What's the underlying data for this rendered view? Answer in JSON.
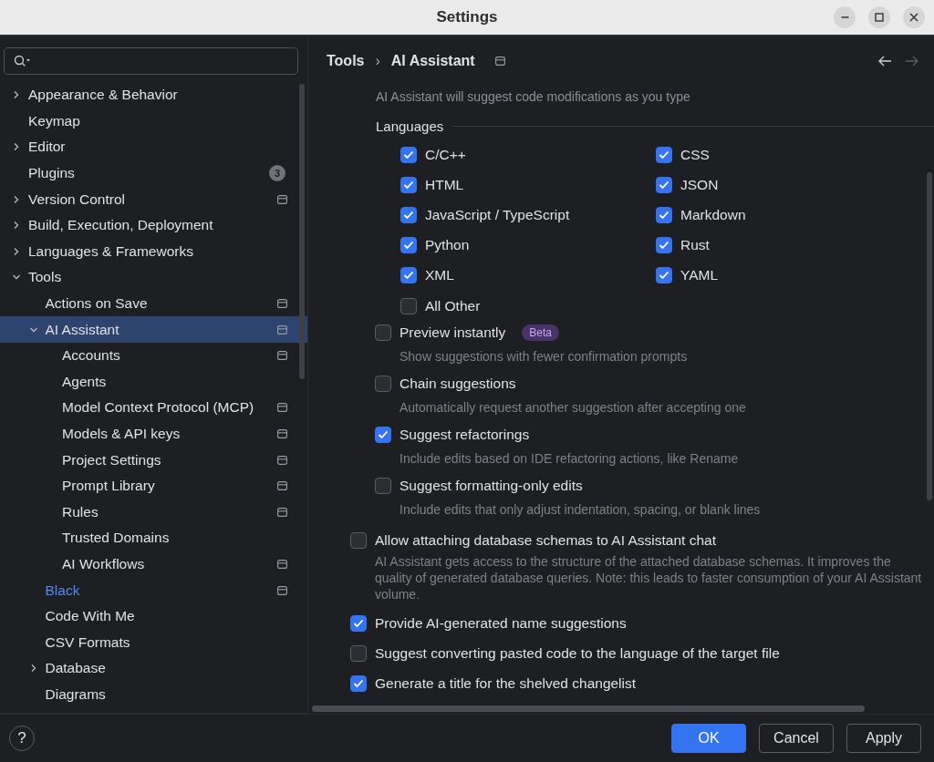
{
  "window": {
    "title": "Settings"
  },
  "sidebar": {
    "items": [
      {
        "label": "Appearance & Behavior",
        "expanded": false,
        "selected": false
      },
      {
        "label": "Keymap",
        "selected": false
      },
      {
        "label": "Editor",
        "expanded": false,
        "selected": false
      },
      {
        "label": "Plugins",
        "selected": false,
        "badge": "3"
      },
      {
        "label": "Version Control",
        "expanded": false,
        "selected": false,
        "project_scoped": true
      },
      {
        "label": "Build, Execution, Deployment",
        "expanded": false,
        "selected": false
      },
      {
        "label": "Languages & Frameworks",
        "expanded": false,
        "selected": false
      },
      {
        "label": "Tools",
        "expanded": true,
        "selected": false,
        "children": [
          {
            "label": "Actions on Save",
            "selected": false,
            "project_scoped": true
          },
          {
            "label": "AI Assistant",
            "expanded": true,
            "selected": true,
            "project_scoped": true,
            "children": [
              {
                "label": "Accounts",
                "selected": false,
                "project_scoped": true
              },
              {
                "label": "Agents",
                "selected": false
              },
              {
                "label": "Model Context Protocol (MCP)",
                "selected": false,
                "project_scoped": true
              },
              {
                "label": "Models & API keys",
                "selected": false,
                "project_scoped": true
              },
              {
                "label": "Project Settings",
                "selected": false,
                "project_scoped": true
              },
              {
                "label": "Prompt Library",
                "selected": false,
                "project_scoped": true
              },
              {
                "label": "Rules",
                "selected": false,
                "project_scoped": true
              },
              {
                "label": "Trusted Domains",
                "selected": false
              },
              {
                "label": "AI Workflows",
                "selected": false,
                "project_scoped": true
              }
            ]
          },
          {
            "label": "Black",
            "selected": false,
            "modified": true,
            "project_scoped": true
          },
          {
            "label": "Code With Me",
            "selected": false
          },
          {
            "label": "CSV Formats",
            "selected": false
          },
          {
            "label": "Database",
            "expanded": false,
            "selected": false
          },
          {
            "label": "Diagrams",
            "selected": false
          }
        ]
      }
    ]
  },
  "breadcrumb": {
    "items": [
      "Tools",
      "AI Assistant"
    ],
    "separator": "›",
    "project_scoped": true
  },
  "navigation": {
    "back_enabled": true,
    "forward_enabled": false
  },
  "intro": "AI Assistant will suggest code modifications as you type",
  "languages": {
    "title": "Languages",
    "items": [
      {
        "label": "C/C++",
        "checked": true
      },
      {
        "label": "CSS",
        "checked": true
      },
      {
        "label": "HTML",
        "checked": true
      },
      {
        "label": "JSON",
        "checked": true
      },
      {
        "label": "JavaScript / TypeScript",
        "checked": true
      },
      {
        "label": "Markdown",
        "checked": true
      },
      {
        "label": "Python",
        "checked": true
      },
      {
        "label": "Rust",
        "checked": true
      },
      {
        "label": "XML",
        "checked": true
      },
      {
        "label": "YAML",
        "checked": true
      },
      {
        "label": "All Other",
        "checked": false
      }
    ]
  },
  "inline_options": [
    {
      "label": "Preview instantly",
      "checked": false,
      "badge": "Beta",
      "description": "Show suggestions with fewer confirmation prompts"
    },
    {
      "label": "Chain suggestions",
      "checked": false,
      "description": "Automatically request another suggestion after accepting one"
    },
    {
      "label": "Suggest refactorings",
      "checked": true,
      "description": "Include edits based on IDE refactoring actions, like Rename"
    },
    {
      "label": "Suggest formatting-only edits",
      "checked": false,
      "description": "Include edits that only adjust indentation, spacing, or blank lines"
    }
  ],
  "options": [
    {
      "label": "Allow attaching database schemas to AI Assistant chat",
      "checked": false,
      "description": "AI Assistant gets access to the structure of the attached database schemas. It improves the quality of generated database queries. Note: this leads to faster consumption of your AI Assistant volume."
    },
    {
      "label": "Provide AI-generated name suggestions",
      "checked": true
    },
    {
      "label": "Suggest converting pasted code to the language of the target file",
      "checked": false
    },
    {
      "label": "Generate a title for the shelved changelist",
      "checked": true
    }
  ],
  "footer": {
    "help": "?",
    "buttons": [
      {
        "label": "OK",
        "kind": "primary"
      },
      {
        "label": "Cancel",
        "kind": "secondary"
      },
      {
        "label": "Apply",
        "kind": "secondary"
      }
    ]
  }
}
